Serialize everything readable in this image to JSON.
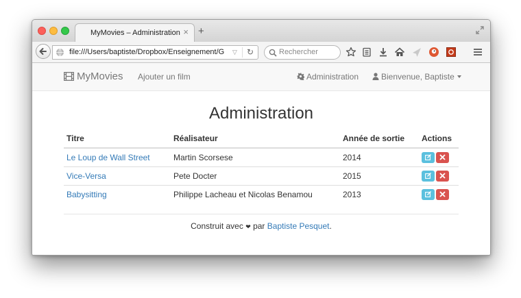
{
  "browser": {
    "tab_title": "MyMovies – Administration",
    "tab_close": "×",
    "new_tab": "+",
    "url": "file:///Users/baptiste/Dropbox/Enseignement/G",
    "search_placeholder": "Rechercher"
  },
  "app": {
    "brand": "MyMovies",
    "add_movie": "Ajouter un film",
    "admin": "Administration",
    "welcome": "Bienvenue, Baptiste"
  },
  "page": {
    "title": "Administration",
    "headers": [
      "Titre",
      "Réalisateur",
      "Année de sortie",
      "Actions"
    ],
    "rows": [
      {
        "title": "Le Loup de Wall Street",
        "director": "Martin Scorsese",
        "year": "2014"
      },
      {
        "title": "Vice-Versa",
        "director": "Pete Docter",
        "year": "2015"
      },
      {
        "title": "Babysitting",
        "director": "Philippe Lacheau et Nicolas Benamou",
        "year": "2013"
      }
    ]
  },
  "footer": {
    "prefix": "Construit avec",
    "heart": "❤",
    "by": "par",
    "author": "Baptiste Pesquet",
    "suffix": "."
  },
  "colors": {
    "link": "#337ab7",
    "edit_button": "#5bc0de",
    "delete_button": "#d9534f"
  }
}
